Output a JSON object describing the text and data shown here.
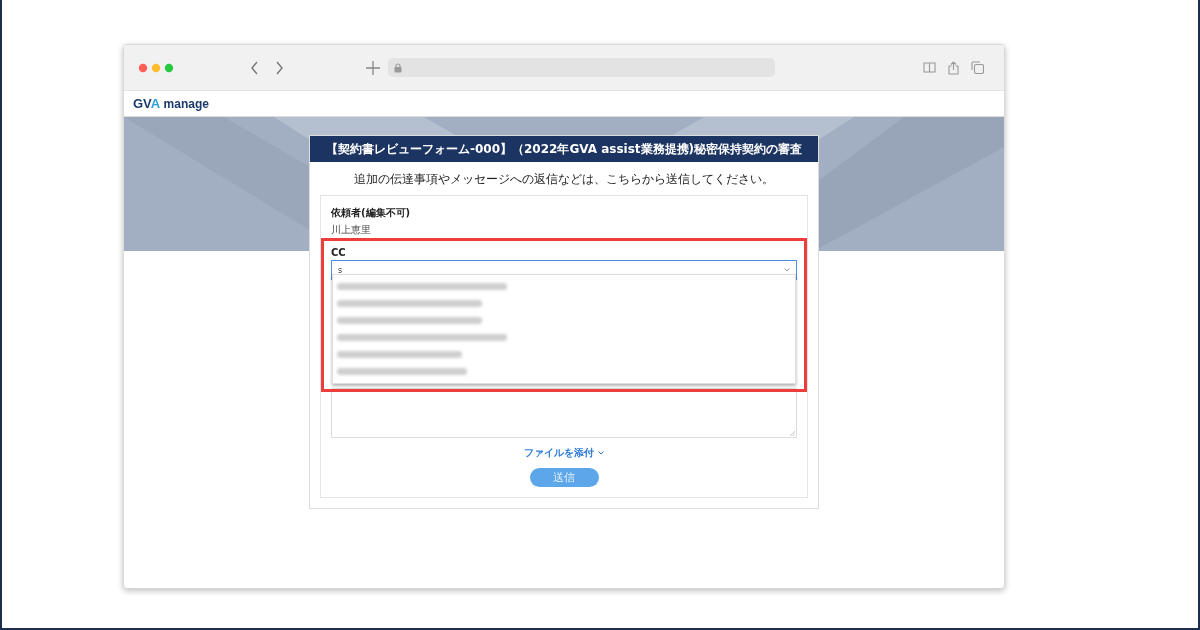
{
  "browser": {
    "logo": {
      "brand": "GVA",
      "product": "manage"
    }
  },
  "modal": {
    "title": "【契約書レビューフォーム-000】（2022年GVA assist業務提携)秘密保持契約の審査",
    "instruction": "追加の伝達事項やメッセージへの返信などは、こちらから送信してください。",
    "requester": {
      "label": "依頼者(編集不可)",
      "value": "川上恵里"
    },
    "cc": {
      "label": "CC",
      "value": "s",
      "expanded": true,
      "options": [
        {
          "kind": "blurred"
        },
        {
          "kind": "blurred"
        },
        {
          "kind": "blurred"
        },
        {
          "kind": "blurred"
        },
        {
          "kind": "blurred"
        },
        {
          "kind": "blurred"
        }
      ]
    },
    "attach_link": "ファイルを添付",
    "submit": "送信"
  }
}
